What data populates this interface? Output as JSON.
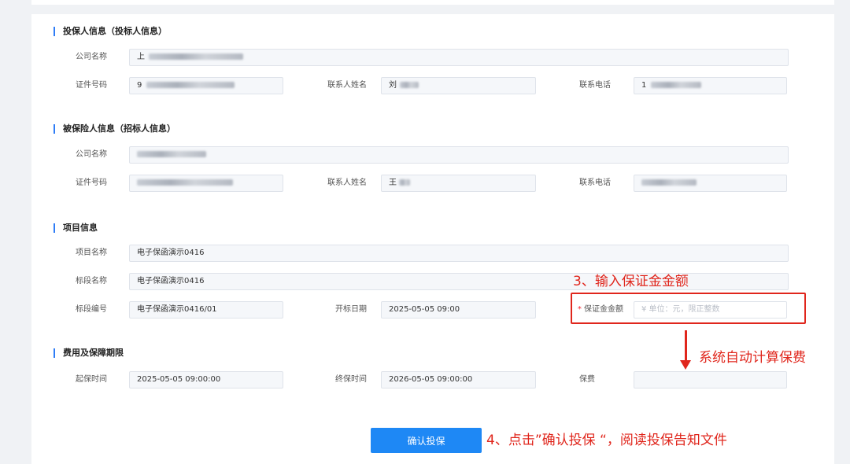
{
  "sections": {
    "insurer": {
      "title": "投保人信息（投标人信息）",
      "company_label": "公司名称",
      "id_label": "证件号码",
      "contact_label": "联系人姓名",
      "phone_label": "联系电话",
      "company_value_prefix": "上",
      "id_value_prefix": "9",
      "contact_value_prefix": "刘",
      "phone_value_prefix": "1"
    },
    "insured": {
      "title": "被保险人信息（招标人信息）",
      "company_label": "公司名称",
      "id_label": "证件号码",
      "contact_label": "联系人姓名",
      "phone_label": "联系电话",
      "company_value_prefix": "",
      "id_value_prefix": "",
      "contact_value_prefix": "王",
      "phone_value_prefix": ""
    },
    "project": {
      "title": "项目信息",
      "name_label": "项目名称",
      "name_value": "电子保函演示0416",
      "section_label": "标段名称",
      "section_value": "电子保函演示0416",
      "section_no_label": "标段编号",
      "section_no_value": "电子保函演示0416/01",
      "open_date_label": "开标日期",
      "open_date_value": "2025-05-05 09:00",
      "bond_required_mark": "*",
      "bond_label": "保证金金额",
      "bond_placeholder": "¥ 单位：元，限正整数"
    },
    "fees": {
      "title": "费用及保障期限",
      "start_label": "起保时间",
      "start_value": "2025-05-05 09:00:00",
      "end_label": "终保时间",
      "end_value": "2026-05-05 09:00:00",
      "premium_label": "保费",
      "premium_value": ""
    }
  },
  "annotations": {
    "step3": "3、输入保证金金额",
    "auto_calc": "系统自动计算保费",
    "step4": "4、点击”确认投保 “，阅读投保告知文件"
  },
  "confirm_button": "确认投保",
  "colors": {
    "accent": "#1e88f5",
    "annotation": "#e0261c"
  }
}
